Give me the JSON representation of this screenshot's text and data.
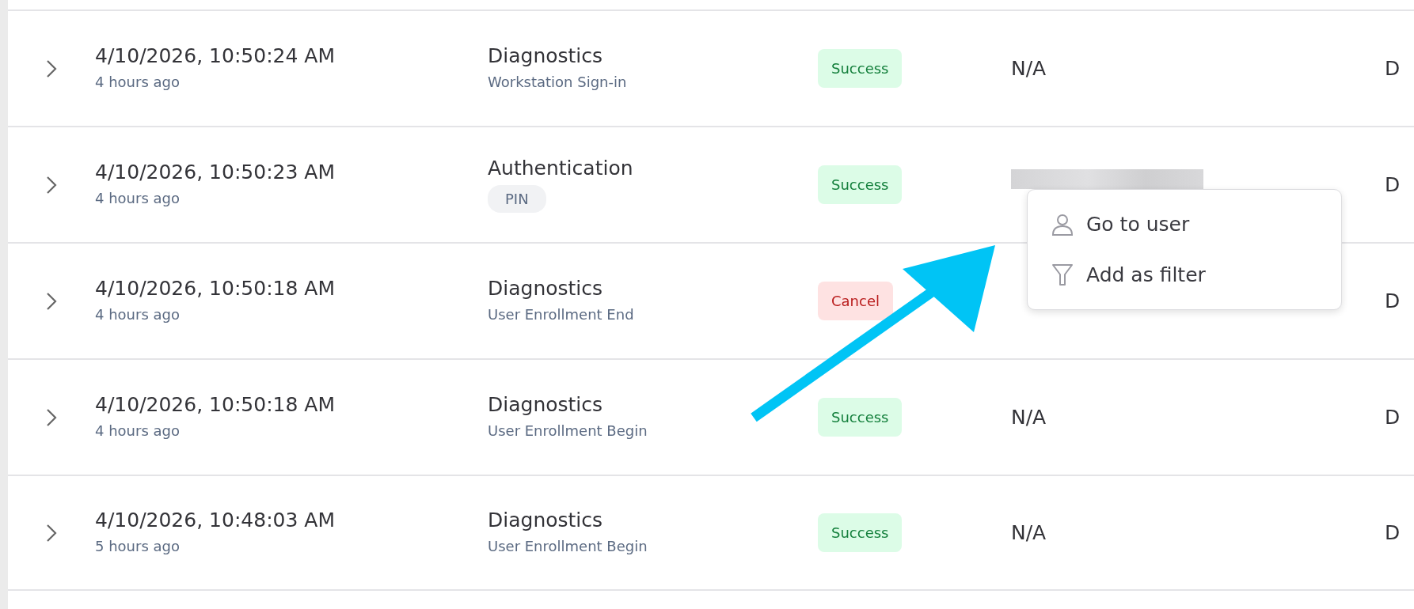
{
  "rows": [
    {
      "time": "4/10/2026, 10:50:24 AM",
      "relative": "4 hours ago",
      "category": "Diagnostics",
      "detail": {
        "text": "Workstation Sign-in",
        "kind": "text"
      },
      "status": {
        "label": "Success",
        "kind": "success"
      },
      "user": {
        "kind": "text",
        "text": "N/A"
      },
      "column_6": "D"
    },
    {
      "time": "4/10/2026, 10:50:23 AM",
      "relative": "4 hours ago",
      "category": "Authentication",
      "detail": {
        "text": "PIN",
        "kind": "tag"
      },
      "status": {
        "label": "Success",
        "kind": "success"
      },
      "user": {
        "kind": "redacted"
      },
      "column_6": "D"
    },
    {
      "time": "4/10/2026, 10:50:18 AM",
      "relative": "4 hours ago",
      "category": "Diagnostics",
      "detail": {
        "text": "User Enrollment End",
        "kind": "text"
      },
      "status": {
        "label": "Cancel",
        "kind": "cancel"
      },
      "column_6": "D"
    },
    {
      "time": "4/10/2026, 10:50:18 AM",
      "relative": "4 hours ago",
      "category": "Diagnostics",
      "detail": {
        "text": "User Enrollment Begin",
        "kind": "text"
      },
      "status": {
        "label": "Success",
        "kind": "success"
      },
      "user": {
        "kind": "text",
        "text": "N/A"
      },
      "column_6": "D"
    },
    {
      "time": "4/10/2026, 10:48:03 AM",
      "relative": "5 hours ago",
      "category": "Diagnostics",
      "detail": {
        "text": "User Enrollment Begin",
        "kind": "text"
      },
      "status": {
        "label": "Success",
        "kind": "success"
      },
      "user": {
        "kind": "text",
        "text": "N/A"
      },
      "column_6": "D"
    }
  ],
  "context_menu": {
    "items": [
      {
        "label": "Go to user"
      },
      {
        "label": "Add as filter"
      }
    ]
  },
  "annotation": {
    "kind": "arrow"
  }
}
